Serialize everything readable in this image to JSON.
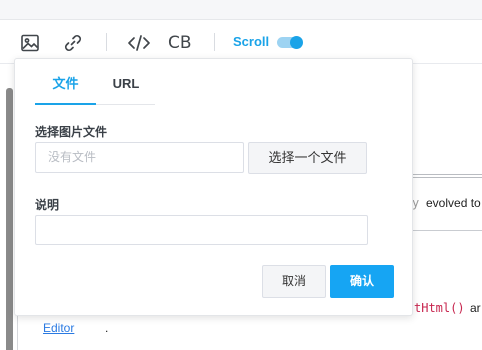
{
  "toolbar": {
    "cb_label": "CB",
    "scroll_label": "Scroll",
    "scroll_enabled": true,
    "accent_color": "#1aa3e8",
    "icons": [
      "image-icon",
      "link-icon",
      "code-icon",
      "code-block-button"
    ]
  },
  "background": {
    "text_line1": "evolved to",
    "code_line2": "tHtml()",
    "text_line2": "ar",
    "link_text": "Editor",
    "link_suffix": "."
  },
  "popup": {
    "tabs": [
      {
        "label": "文件",
        "active": true
      },
      {
        "label": "URL",
        "active": false
      }
    ],
    "file_section": {
      "label": "选择图片文件",
      "placeholder": "没有文件",
      "choose_button": "选择一个文件"
    },
    "description": {
      "label": "说明",
      "value": ""
    },
    "buttons": {
      "cancel": "取消",
      "confirm": "确认"
    }
  }
}
